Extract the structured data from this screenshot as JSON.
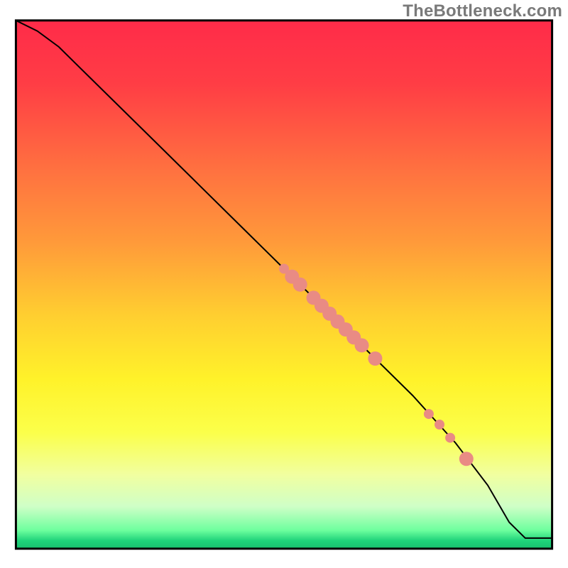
{
  "watermark": "TheBottleneck.com",
  "chart_data": {
    "type": "line",
    "title": "",
    "xlabel": "",
    "ylabel": "",
    "xlim": [
      0,
      100
    ],
    "ylim": [
      0,
      100
    ],
    "background_gradient_stops": [
      {
        "offset": 0.0,
        "color": "#ff2b49"
      },
      {
        "offset": 0.12,
        "color": "#ff3d45"
      },
      {
        "offset": 0.28,
        "color": "#ff7040"
      },
      {
        "offset": 0.42,
        "color": "#ff9a3a"
      },
      {
        "offset": 0.56,
        "color": "#ffcf30"
      },
      {
        "offset": 0.68,
        "color": "#fff22a"
      },
      {
        "offset": 0.78,
        "color": "#fbff4a"
      },
      {
        "offset": 0.86,
        "color": "#f1ffa0"
      },
      {
        "offset": 0.92,
        "color": "#cfffc7"
      },
      {
        "offset": 0.965,
        "color": "#6eff9e"
      },
      {
        "offset": 0.985,
        "color": "#1fd37a"
      },
      {
        "offset": 1.0,
        "color": "#18c06e"
      }
    ],
    "series": [
      {
        "name": "curve",
        "x": [
          0,
          4,
          8,
          12,
          18,
          26,
          34,
          42,
          50,
          58,
          66,
          74,
          82,
          88,
          92,
          95,
          100
        ],
        "y": [
          100,
          98,
          95,
          91,
          85,
          77,
          69,
          61,
          53,
          45,
          37,
          29,
          20,
          12,
          5,
          2,
          2
        ]
      }
    ],
    "markers": {
      "color": "#e98b84",
      "radius_small": 7,
      "radius_large": 10,
      "points": [
        {
          "x": 50.0,
          "y": 53.0,
          "r": "small"
        },
        {
          "x": 51.5,
          "y": 51.5,
          "r": "large"
        },
        {
          "x": 53.0,
          "y": 50.0,
          "r": "large"
        },
        {
          "x": 55.5,
          "y": 47.5,
          "r": "large"
        },
        {
          "x": 57.0,
          "y": 46.0,
          "r": "large"
        },
        {
          "x": 58.5,
          "y": 44.5,
          "r": "large"
        },
        {
          "x": 60.0,
          "y": 43.0,
          "r": "large"
        },
        {
          "x": 61.5,
          "y": 41.5,
          "r": "large"
        },
        {
          "x": 63.0,
          "y": 40.0,
          "r": "large"
        },
        {
          "x": 64.5,
          "y": 38.5,
          "r": "large"
        },
        {
          "x": 67.0,
          "y": 36.0,
          "r": "large"
        },
        {
          "x": 77.0,
          "y": 25.5,
          "r": "small"
        },
        {
          "x": 79.0,
          "y": 23.5,
          "r": "small"
        },
        {
          "x": 81.0,
          "y": 21.0,
          "r": "small"
        },
        {
          "x": 84.0,
          "y": 17.0,
          "r": "large"
        }
      ]
    },
    "frame": {
      "x": 2.8,
      "y": 3.6,
      "w": 94.4,
      "h": 93.0,
      "stroke": "#000000",
      "stroke_width": 3
    }
  }
}
